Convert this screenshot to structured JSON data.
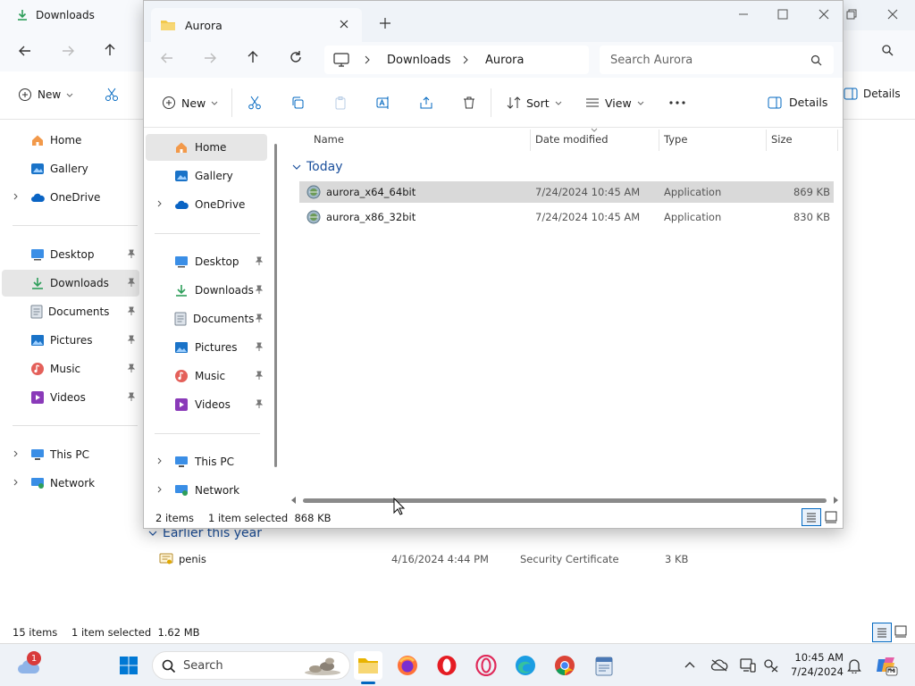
{
  "background_window": {
    "tab_title": "Downloads",
    "toolbar": {
      "new_label": "New",
      "details_label": "Details"
    },
    "sidebar": [
      {
        "label": "Home",
        "icon": "home-icon"
      },
      {
        "label": "Gallery",
        "icon": "gallery-icon"
      },
      {
        "label": "OneDrive",
        "icon": "onedrive-icon"
      },
      {
        "label": "Desktop",
        "icon": "desktop-icon"
      },
      {
        "label": "Downloads",
        "icon": "downloads-icon"
      },
      {
        "label": "Documents",
        "icon": "documents-icon"
      },
      {
        "label": "Pictures",
        "icon": "pictures-icon"
      },
      {
        "label": "Music",
        "icon": "music-icon"
      },
      {
        "label": "Videos",
        "icon": "videos-icon"
      },
      {
        "label": "This PC",
        "icon": "this-pc-icon"
      },
      {
        "label": "Network",
        "icon": "network-icon"
      }
    ],
    "group_label": "Earlier this year",
    "file": {
      "name": "penis",
      "date": "4/16/2024 4:44 PM",
      "type": "Security Certificate",
      "size": "3 KB"
    },
    "status": {
      "count": "15 items",
      "selection": "1 item selected  1.62 MB"
    }
  },
  "window": {
    "tab_title": "Aurora",
    "breadcrumb": [
      "Downloads",
      "Aurora"
    ],
    "search_placeholder": "Search Aurora",
    "toolbar": {
      "new_label": "New",
      "sort_label": "Sort",
      "view_label": "View",
      "details_label": "Details"
    },
    "sidebar": [
      {
        "label": "Home",
        "icon": "home-icon"
      },
      {
        "label": "Gallery",
        "icon": "gallery-icon"
      },
      {
        "label": "OneDrive",
        "icon": "onedrive-icon"
      },
      {
        "label": "Desktop",
        "icon": "desktop-icon"
      },
      {
        "label": "Downloads",
        "icon": "downloads-icon"
      },
      {
        "label": "Documents",
        "icon": "documents-icon"
      },
      {
        "label": "Pictures",
        "icon": "pictures-icon"
      },
      {
        "label": "Music",
        "icon": "music-icon"
      },
      {
        "label": "Videos",
        "icon": "videos-icon"
      },
      {
        "label": "This PC",
        "icon": "this-pc-icon"
      },
      {
        "label": "Network",
        "icon": "network-icon"
      }
    ],
    "columns": [
      "Name",
      "Date modified",
      "Type",
      "Size"
    ],
    "group_label": "Today",
    "files": [
      {
        "name": "aurora_x64_64bit",
        "date": "7/24/2024 10:45 AM",
        "type": "Application",
        "size": "869 KB",
        "selected": true
      },
      {
        "name": "aurora_x86_32bit",
        "date": "7/24/2024 10:45 AM",
        "type": "Application",
        "size": "830 KB",
        "selected": false
      }
    ],
    "status": {
      "count": "2 items",
      "selection": "1 item selected  868 KB"
    }
  },
  "taskbar": {
    "search_label": "Search",
    "notification_count": "1",
    "clock": {
      "time": "10:45 AM",
      "date": "7/24/2024"
    }
  },
  "colors": {
    "accent": "#0067c0",
    "folder": "#f2c94c",
    "selection": "#d9d9d9",
    "downloads_green": "#2e9e5a"
  }
}
